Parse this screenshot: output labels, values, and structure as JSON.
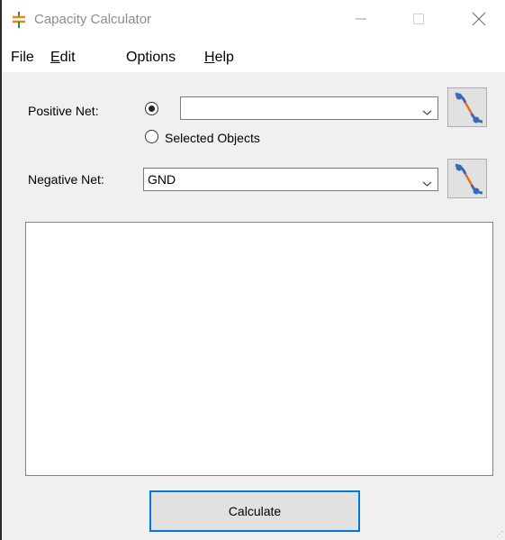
{
  "window": {
    "title": "Capacity Calculator"
  },
  "menu": {
    "file": {
      "mnemonic": "",
      "rest": "File"
    },
    "edit": {
      "mnemonic": "E",
      "rest": "dit"
    },
    "options": {
      "mnemonic": "",
      "rest": "Options"
    },
    "help": {
      "mnemonic": "H",
      "rest": "elp"
    }
  },
  "positive_net": {
    "label": "Positive Net:",
    "combo_value": "",
    "radio_combo_selected": true,
    "radio_selected_objects_label": "Selected Objects"
  },
  "negative_net": {
    "label": "Negative Net:",
    "combo_value": "GND"
  },
  "results": {
    "text": ""
  },
  "buttons": {
    "calculate": "Calculate"
  },
  "icons": {
    "app": "capacitor-icon",
    "net_picker": "net-picker-icon",
    "minimize": "minimize-icon",
    "maximize": "maximize-icon",
    "close": "close-icon",
    "dropdown": "chevron-down-icon"
  },
  "colors": {
    "accent": "#0078d7",
    "app_icon_green": "#2e8b2e",
    "app_icon_orange": "#e0891b",
    "picker_blue": "#3a6ab0",
    "picker_orange": "#e07020"
  }
}
